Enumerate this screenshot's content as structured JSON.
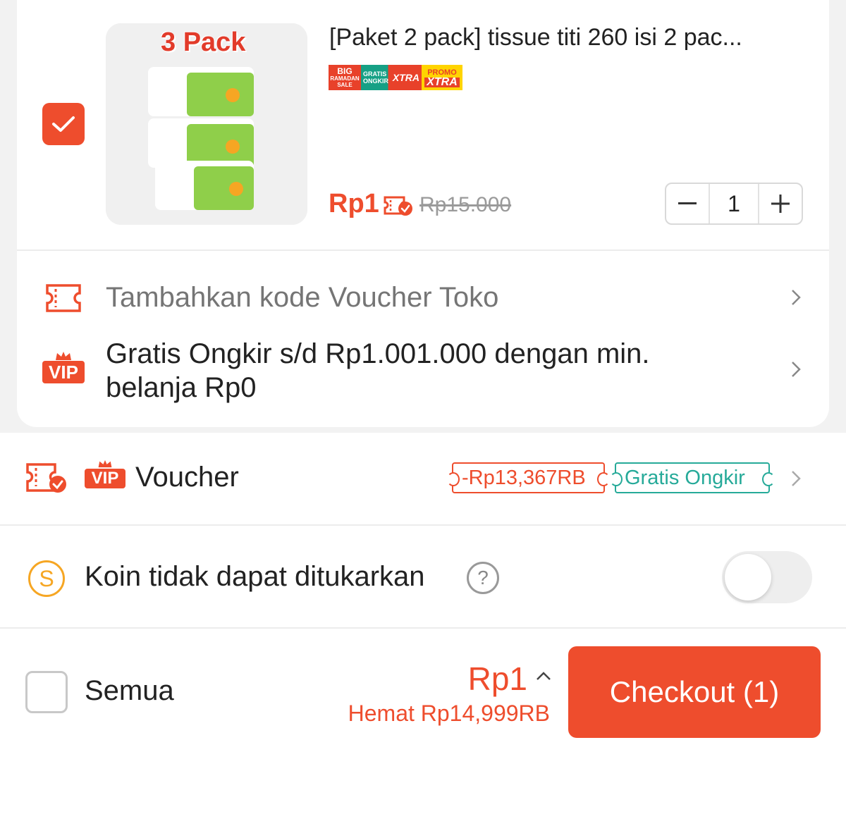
{
  "product": {
    "image_label": "3 Pack",
    "title": "[Paket 2 pack] tissue titi 260 isi 2 pac...",
    "badges": [
      {
        "name": "big-ramadan-sale-badge",
        "lines": [
          "BIG",
          "RAMADAN",
          "SALE"
        ]
      },
      {
        "name": "gratis-ongkir-xtra-badge",
        "lines": [
          "GRATIS",
          "ONGKIR",
          "XTRA"
        ]
      },
      {
        "name": "promo-xtra-badge",
        "lines": [
          "PROMO",
          "XTRA"
        ]
      }
    ],
    "price": "Rp1",
    "original_price": "Rp15.000",
    "quantity": "1",
    "checked": true
  },
  "shop_voucher": {
    "label": "Tambahkan kode Voucher Toko"
  },
  "vip_shipping": {
    "badge": "VIP",
    "text": "Gratis Ongkir s/d Rp1.001.000 dengan min. belanja Rp0"
  },
  "voucher_row": {
    "badge": "VIP",
    "label": "Voucher",
    "discount_pill": "-Rp13,367RB",
    "shipping_pill": "Gratis Ongkir"
  },
  "coins_row": {
    "icon_letter": "S",
    "label": "Koin tidak dapat ditukarkan",
    "help_symbol": "?",
    "toggle_on": false
  },
  "footer": {
    "select_all_label": "Semua",
    "total": "Rp1",
    "savings": "Hemat Rp14,999RB",
    "checkout_label": "Checkout (1)"
  },
  "colors": {
    "accent": "#ee4d2d",
    "teal": "#26aa99",
    "coin": "#f6a623"
  }
}
